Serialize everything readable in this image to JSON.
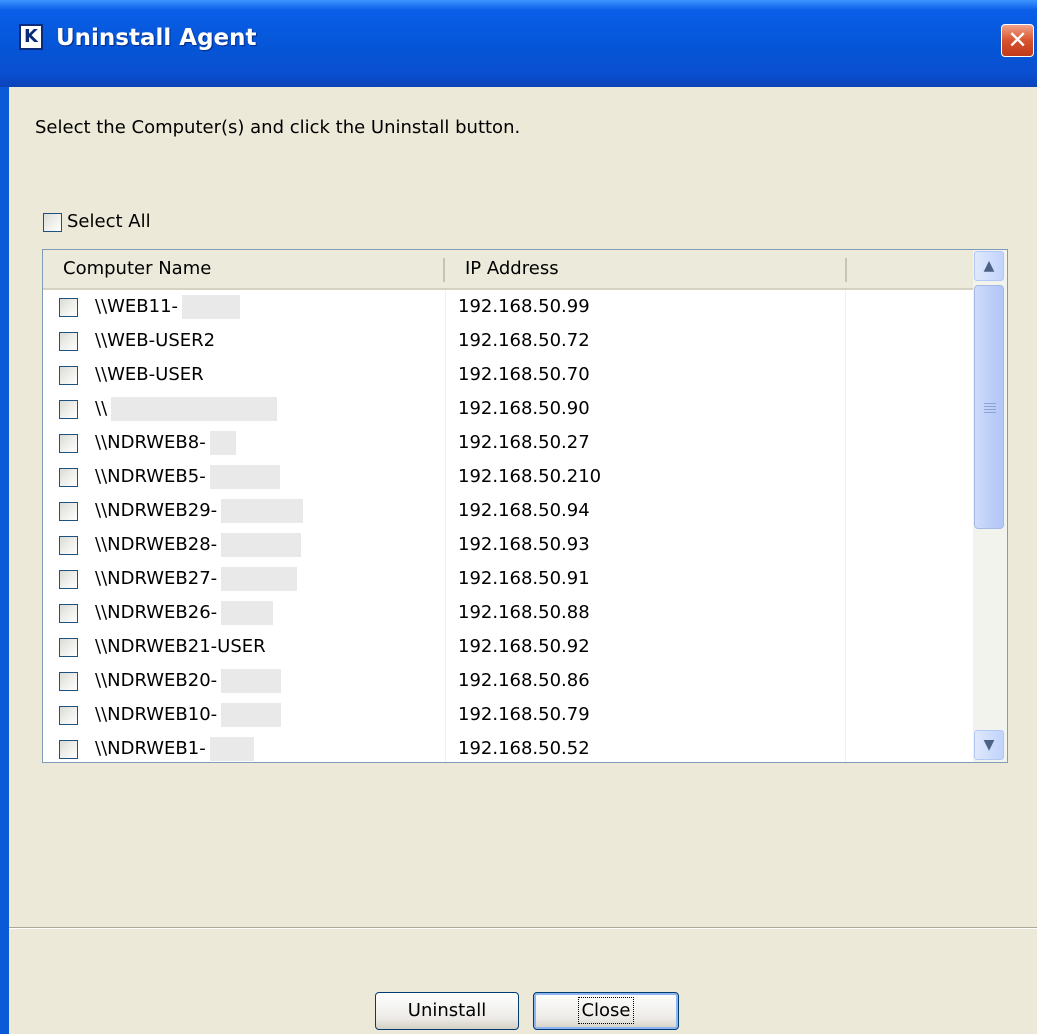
{
  "window": {
    "title": "Uninstall Agent",
    "icon_letter": "K",
    "close_glyph": "✕"
  },
  "instruction": "Select the Computer(s) and click the Uninstall button.",
  "select_all_label": "Select All",
  "columns": [
    "Computer Name",
    "IP Address"
  ],
  "rows": [
    {
      "name": "\\\\WEB11-",
      "ip": "192.168.50.99"
    },
    {
      "name": "\\\\WEB-USER2",
      "ip": "192.168.50.72"
    },
    {
      "name": "\\\\WEB-USER",
      "ip": "192.168.50.70"
    },
    {
      "name": "\\\\",
      "ip": "192.168.50.90"
    },
    {
      "name": "\\\\NDRWEB8-",
      "ip": "192.168.50.27"
    },
    {
      "name": "\\\\NDRWEB5-",
      "ip": "192.168.50.210"
    },
    {
      "name": "\\\\NDRWEB29-",
      "ip": "192.168.50.94"
    },
    {
      "name": "\\\\NDRWEB28-",
      "ip": "192.168.50.93"
    },
    {
      "name": "\\\\NDRWEB27-",
      "ip": "192.168.50.91"
    },
    {
      "name": "\\\\NDRWEB26-",
      "ip": "192.168.50.88"
    },
    {
      "name": "\\\\NDRWEB21-USER",
      "ip": "192.168.50.92"
    },
    {
      "name": "\\\\NDRWEB20-",
      "ip": "192.168.50.86"
    },
    {
      "name": "\\\\NDRWEB10-",
      "ip": "192.168.50.79"
    },
    {
      "name": "\\\\NDRWEB1-",
      "ip": "192.168.50.52"
    }
  ],
  "scroll": {
    "up_glyph": "▲",
    "down_glyph": "▼"
  },
  "buttons": {
    "uninstall": "Uninstall",
    "close": "Close"
  },
  "colors": {
    "titlebar": "#0556d8",
    "dialog_bg": "#ece9d8",
    "close_button": "#d8532f"
  }
}
